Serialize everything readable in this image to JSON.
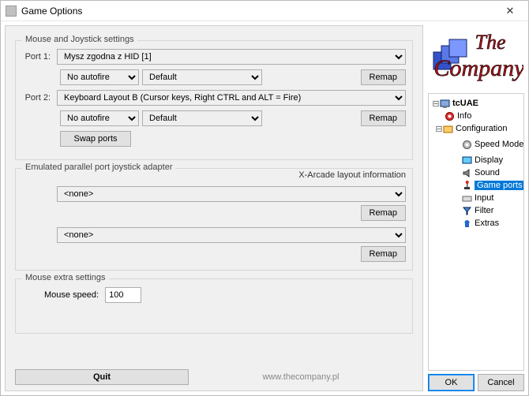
{
  "window": {
    "title": "Game Options"
  },
  "groups": {
    "mouse_joy": "Mouse and Joystick settings",
    "parallel": "Emulated parallel port joystick adapter",
    "mouse_extra": "Mouse extra settings"
  },
  "port1": {
    "label": "Port 1:",
    "device": "Mysz zgodna z HID [1]",
    "autofire": "No autofire",
    "mode": "Default",
    "remap": "Remap"
  },
  "port2": {
    "label": "Port 2:",
    "device": "Keyboard Layout B (Cursor keys, Right CTRL and ALT = Fire)",
    "autofire": "No autofire",
    "mode": "Default",
    "remap": "Remap"
  },
  "swap_label": "Swap ports",
  "xarcade_label": "X-Arcade layout information",
  "adapters": {
    "a": {
      "value": "<none>",
      "remap": "Remap"
    },
    "b": {
      "value": "<none>",
      "remap": "Remap"
    }
  },
  "mouse": {
    "label": "Mouse speed:",
    "value": "100"
  },
  "bottom": {
    "quit": "Quit",
    "url": "www.thecompany.pl"
  },
  "tree": {
    "root": "tcUAE",
    "info": "Info",
    "configuration": "Configuration",
    "speed_mode": "Speed Mode",
    "display": "Display",
    "sound": "Sound",
    "game_ports": "Game ports",
    "input": "Input",
    "filter": "Filter",
    "extras": "Extras"
  },
  "buttons": {
    "ok": "OK",
    "cancel": "Cancel"
  },
  "logo_text": {
    "the": "The",
    "company": "Company"
  }
}
